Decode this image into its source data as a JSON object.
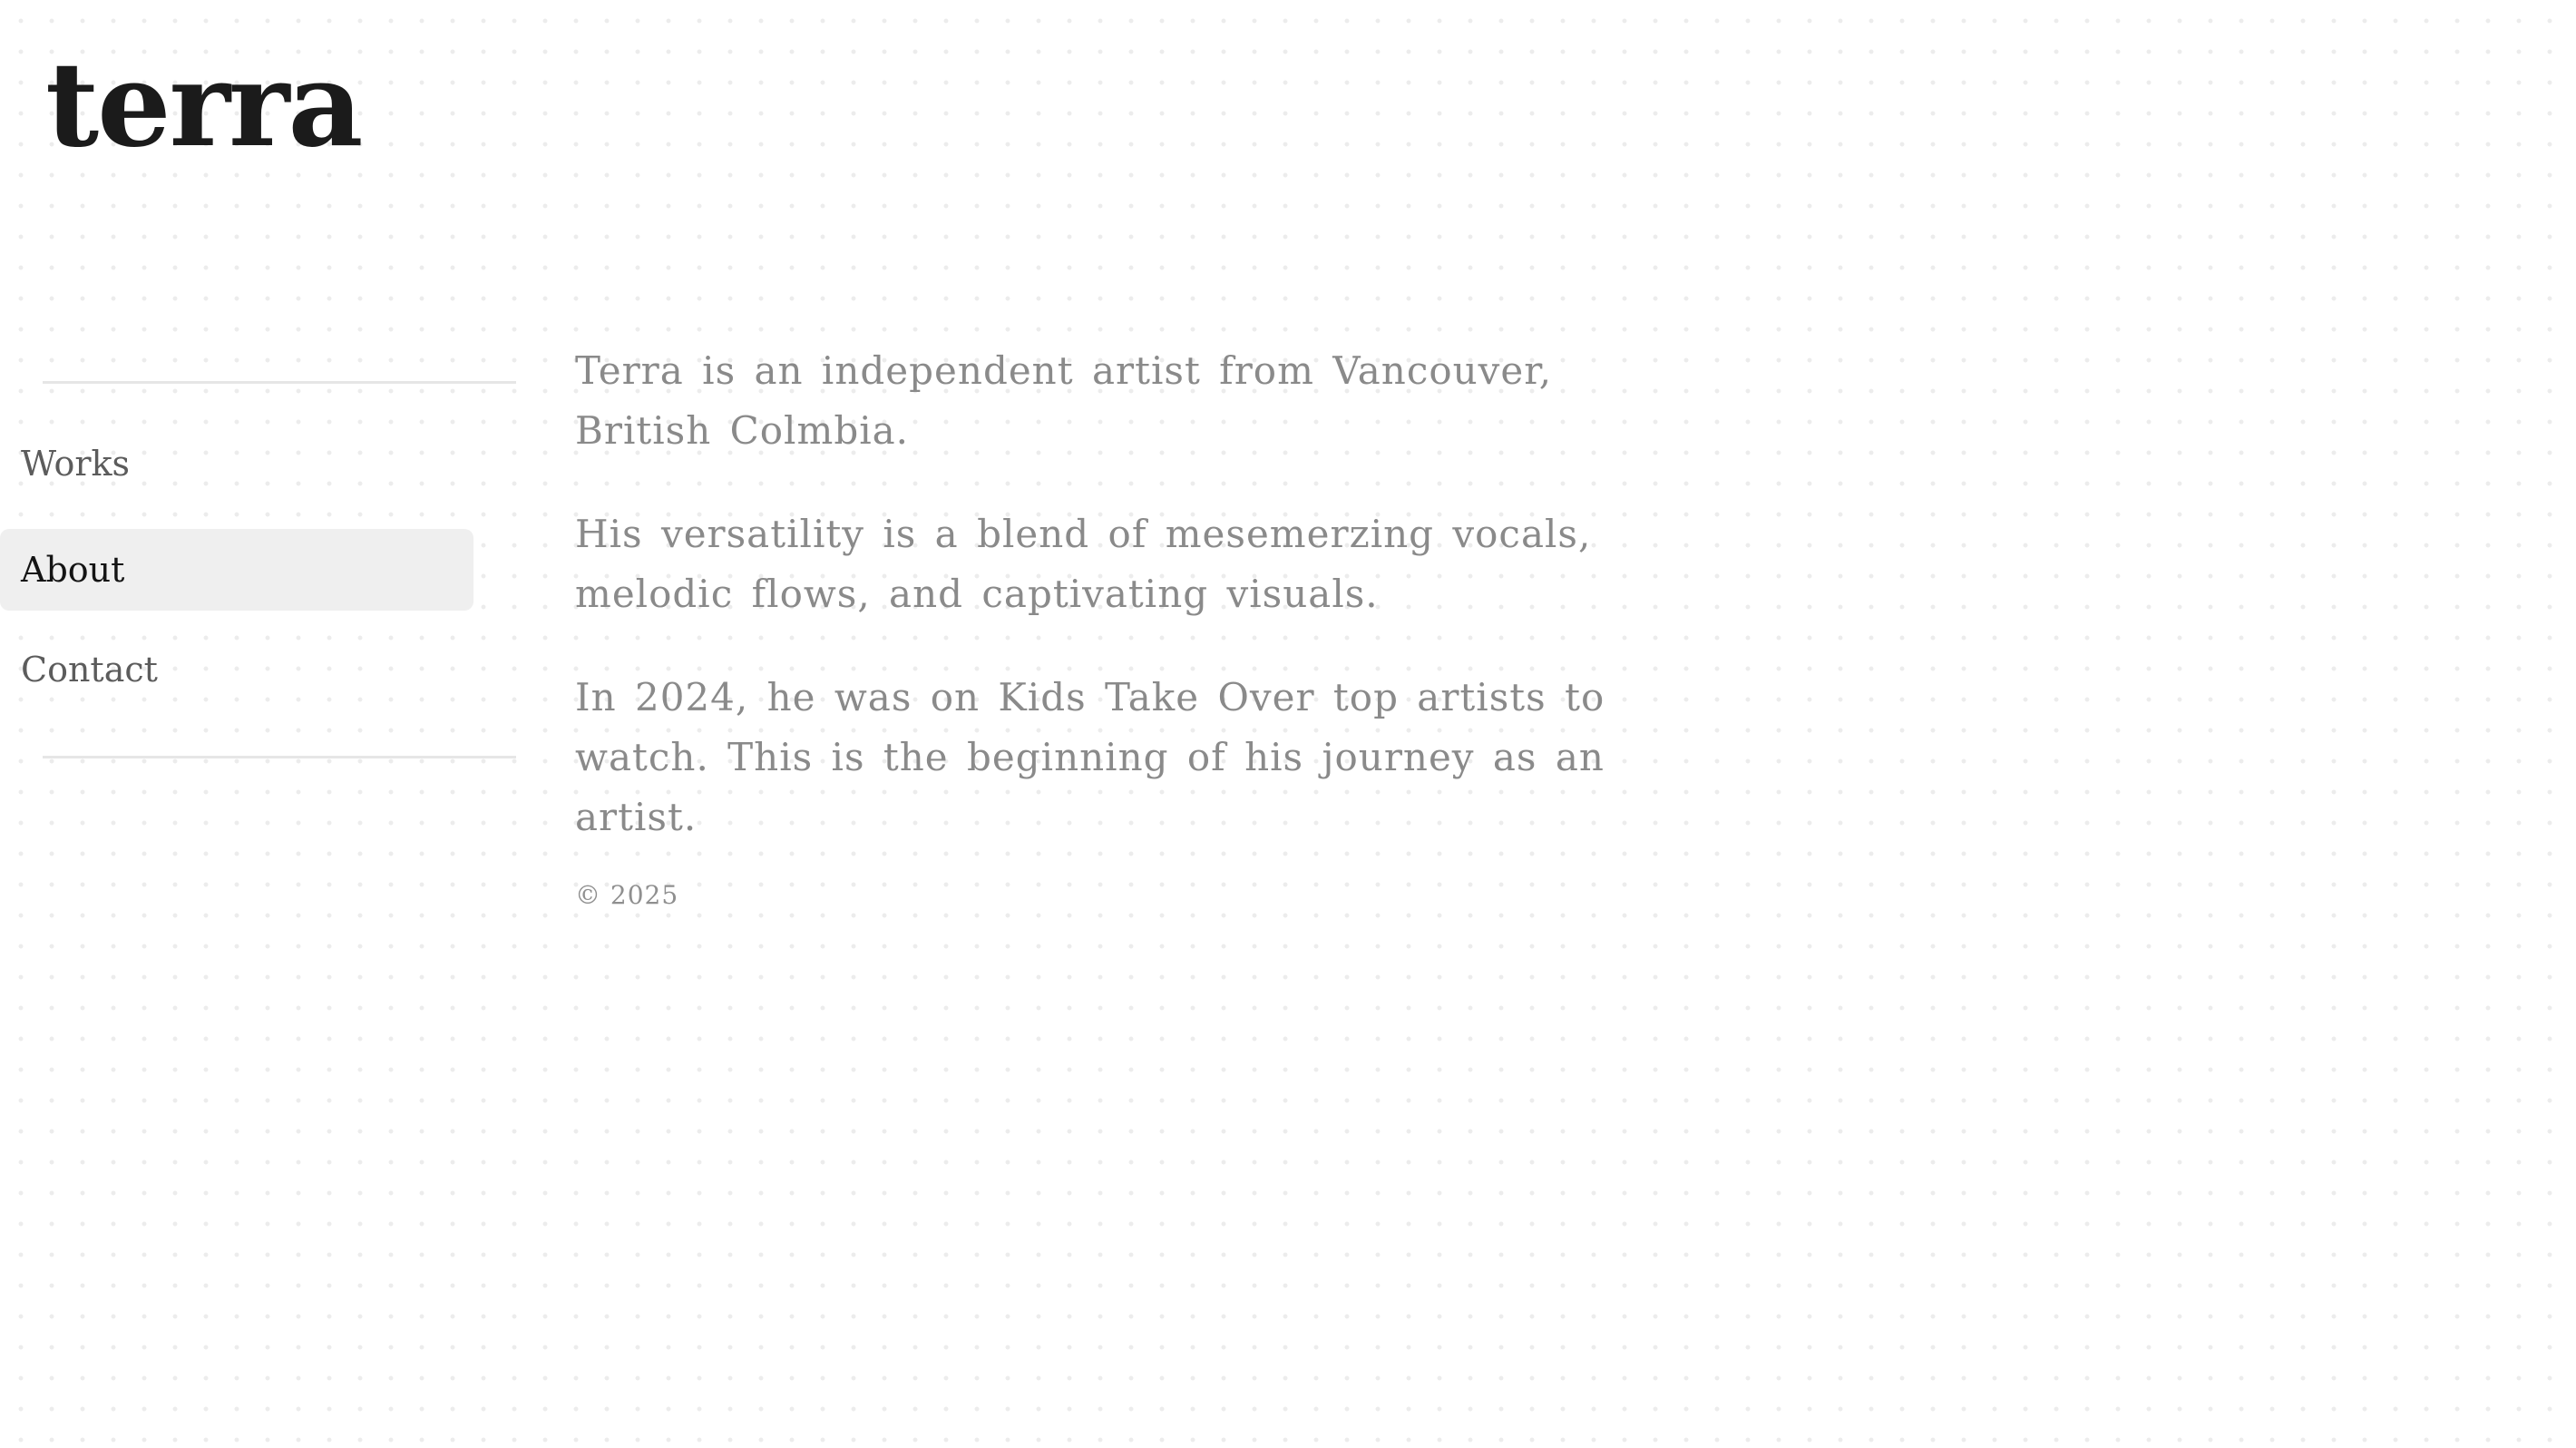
{
  "site": {
    "logo": "terra"
  },
  "nav": {
    "items": [
      {
        "label": "Works",
        "active": false
      },
      {
        "label": "About",
        "active": true
      },
      {
        "label": "Contact",
        "active": false
      }
    ]
  },
  "about": {
    "paragraphs": [
      "Terra is an independent artist from Vancouver, British Colmbia.",
      "His versatility is a blend of mesemerzing vocals, melodic flows, and captivating visuals.",
      "In 2024, he was on Kids Take Over top artists to watch. This is the beginning of his journey as an artist."
    ]
  },
  "footer": {
    "copyright": "© 2025"
  },
  "colors": {
    "logo": "#1b1b1b",
    "nav_text": "#5c5c5c",
    "nav_active_bg": "#efefef",
    "nav_active_text": "#141414",
    "body_text": "#8a8a8a",
    "divider": "#e6e6e6",
    "dot_pattern": "#ececec"
  }
}
